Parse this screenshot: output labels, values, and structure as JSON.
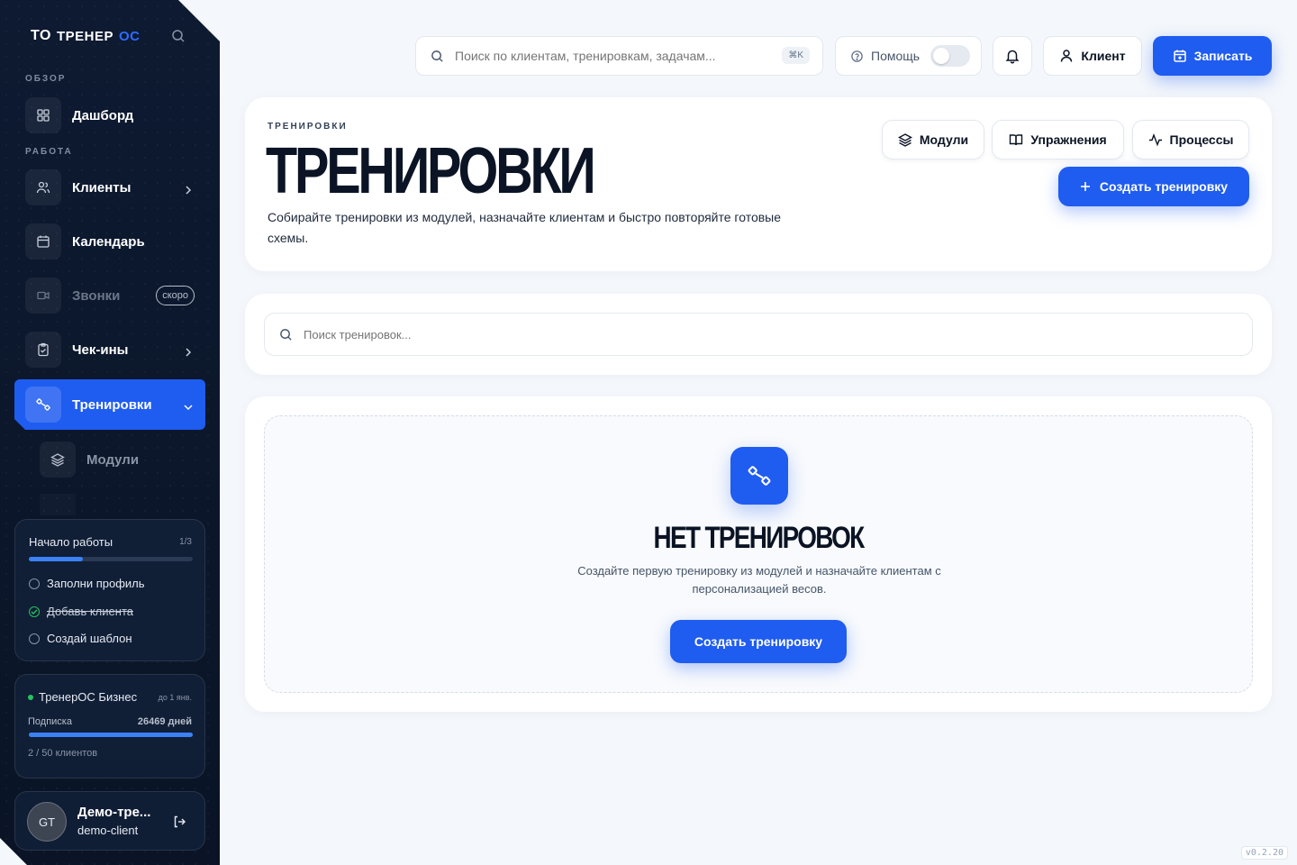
{
  "brand": {
    "logo_mark": "TO",
    "name": "ТРЕНЕР",
    "name_suffix": "ОС"
  },
  "sidebar": {
    "sections": {
      "overview": "ОБЗОР",
      "work": "РАБОТА"
    },
    "items": {
      "dashboard": "Дашборд",
      "clients": "Клиенты",
      "calendar": "Календарь",
      "calls": "Звонки",
      "calls_badge": "скоро",
      "checkins": "Чек-ины",
      "workouts": "Тренировки",
      "modules": "Модули"
    },
    "onboarding": {
      "title": "Начало работы",
      "count": "1/3",
      "progress": 0.33,
      "tasks": [
        "Заполни профиль",
        "Добавь клиента",
        "Создай шаблон"
      ]
    },
    "plan": {
      "name": "ТренерОС Бизнес",
      "until": "до 1 янв.",
      "subscription_label": "Подписка",
      "days": "26469 дней",
      "clients": "2 / 50 клиентов"
    },
    "user": {
      "initials": "GT",
      "name": "Демо-тре...",
      "role": "demo-client"
    }
  },
  "topbar": {
    "search_placeholder": "Поиск по клиентам, тренировкам, задачам...",
    "shortcut": "⌘K",
    "help": "Помощь",
    "client_button": "Клиент",
    "book_button": "Записать"
  },
  "header": {
    "eyebrow": "ТРЕНИРОВКИ",
    "title": "ТРЕНИРОВКИ",
    "description": "Собирайте тренировки из модулей, назначайте клиентам и быстро повторяйте готовые схемы.",
    "buttons": {
      "modules": "Модули",
      "exercises": "Упражнения",
      "processes": "Процессы",
      "create": "Создать тренировку"
    }
  },
  "search": {
    "placeholder": "Поиск тренировок..."
  },
  "empty": {
    "title": "НЕТ ТРЕНИРОВОК",
    "description": "Создайте первую тренировку из модулей и назначайте клиентам с персонализацией весов.",
    "button": "Создать тренировку"
  },
  "version": "v0.2.20"
}
